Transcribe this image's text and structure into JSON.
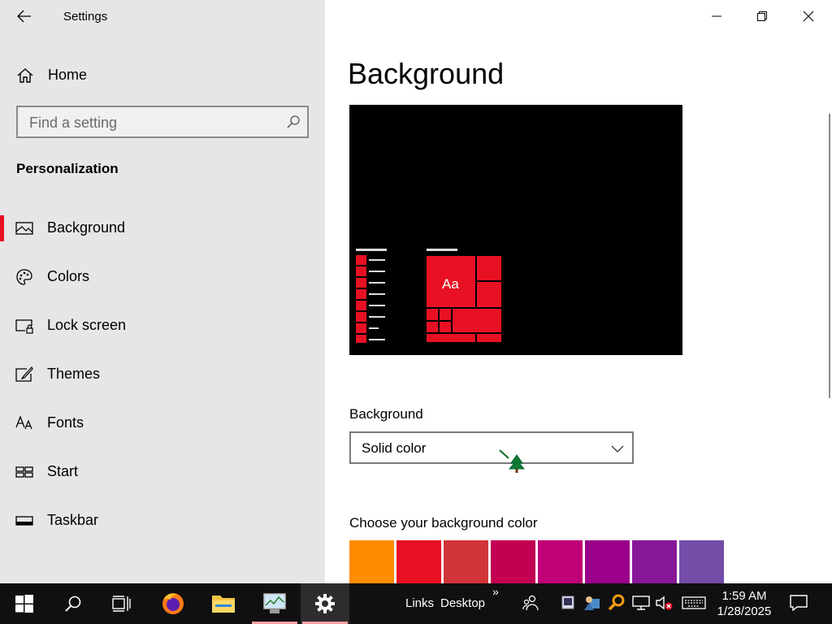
{
  "window": {
    "title": "Settings"
  },
  "sidebar": {
    "home_label": "Home",
    "search_placeholder": "Find a setting",
    "section_title": "Personalization",
    "items": [
      {
        "label": "Background",
        "icon": "image-icon",
        "active": true
      },
      {
        "label": "Colors",
        "icon": "palette-icon",
        "active": false
      },
      {
        "label": "Lock screen",
        "icon": "lock-screen-icon",
        "active": false
      },
      {
        "label": "Themes",
        "icon": "themes-icon",
        "active": false
      },
      {
        "label": "Fonts",
        "icon": "fonts-icon",
        "active": false
      },
      {
        "label": "Start",
        "icon": "start-icon",
        "active": false
      },
      {
        "label": "Taskbar",
        "icon": "taskbar-icon",
        "active": false
      }
    ]
  },
  "main": {
    "title": "Background",
    "preview": {
      "tile_text": "Aa",
      "accent": "#e81123"
    },
    "background_label": "Background",
    "background_value": "Solid color",
    "color_label": "Choose your background color",
    "swatches": [
      "#ff8c00",
      "#e81123",
      "#d13438",
      "#c30052",
      "#bf0077",
      "#9a0089",
      "#881798",
      "#744da9"
    ]
  },
  "taskbar": {
    "links_label": "Links",
    "desktop_label": "Desktop",
    "overflow_glyph": "»",
    "time": "1:59 AM",
    "date": "1/28/2025"
  },
  "colors": {
    "accent": "#e81123",
    "sidebar_bg": "#e6e6e6",
    "taskbar_bg": "#101010"
  }
}
